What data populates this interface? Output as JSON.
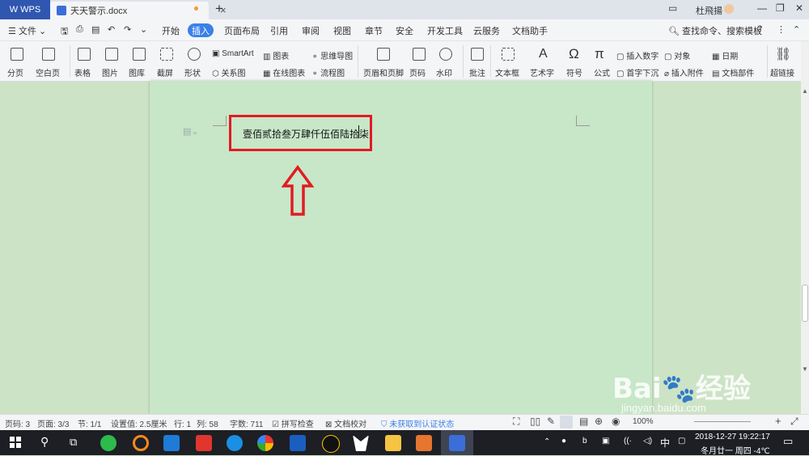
{
  "titlebar": {
    "app_name": "WPS",
    "doc_tab": "天天警示.docx",
    "new_tab_icon": "+",
    "user": "杜飛揚",
    "close_tab": "×"
  },
  "menubar": {
    "file": "文件",
    "items": [
      "开始",
      "插入",
      "页面布局",
      "引用",
      "审阅",
      "视图",
      "章节",
      "安全",
      "开发工具",
      "云服务",
      "文档助手"
    ],
    "active": "插入",
    "search": "查找命令、搜索模板"
  },
  "ribbon": {
    "page_break": "分页",
    "blank_page": "空白页",
    "table": "表格",
    "picture": "图片",
    "gallery": "图库",
    "screenshot": "截屏",
    "shapes": "形状",
    "smartart": "SmartArt",
    "chart": "图表",
    "mindmap": "思维导图",
    "relation": "关系图",
    "online_chart": "在线图表",
    "flowchart": "流程图",
    "header_footer": "页眉和页脚",
    "page_number": "页码",
    "watermark": "水印",
    "comment": "批注",
    "textbox": "文本框",
    "wordart": "艺术字",
    "symbol": "符号",
    "formula": "公式",
    "insert_number": "插入数字",
    "object": "对象",
    "date": "日期",
    "dropcap": "首字下沉",
    "attachment": "插入附件",
    "doc_parts": "文档部件",
    "hyperlink": "超链接"
  },
  "document": {
    "text": "壹佰贰拾叁万肆仟伍佰陆拾柒"
  },
  "statusbar": {
    "page_no": "页码: 3",
    "pages": "页面: 3/3",
    "section": "节: 1/1",
    "setting": "设置值: 2.5厘米",
    "row": "行: 1",
    "col": "列: 58",
    "words": "字数: 711",
    "spell": "拼写检查",
    "proof": "文档校对",
    "cert": "未获取到认证状态",
    "zoom": "100%"
  },
  "taskbar": {
    "ime": "中",
    "datetime": "2018-12-27  19:22:17",
    "date2": "冬月廿一 周四 -4℃"
  },
  "watermark": {
    "brand": "Bai🐾经验",
    "url": "jingyan.baidu.com"
  },
  "colors": {
    "accent": "#3b80e8",
    "highlight_box": "#e11b22",
    "page_bg": "#c8e6c8"
  }
}
